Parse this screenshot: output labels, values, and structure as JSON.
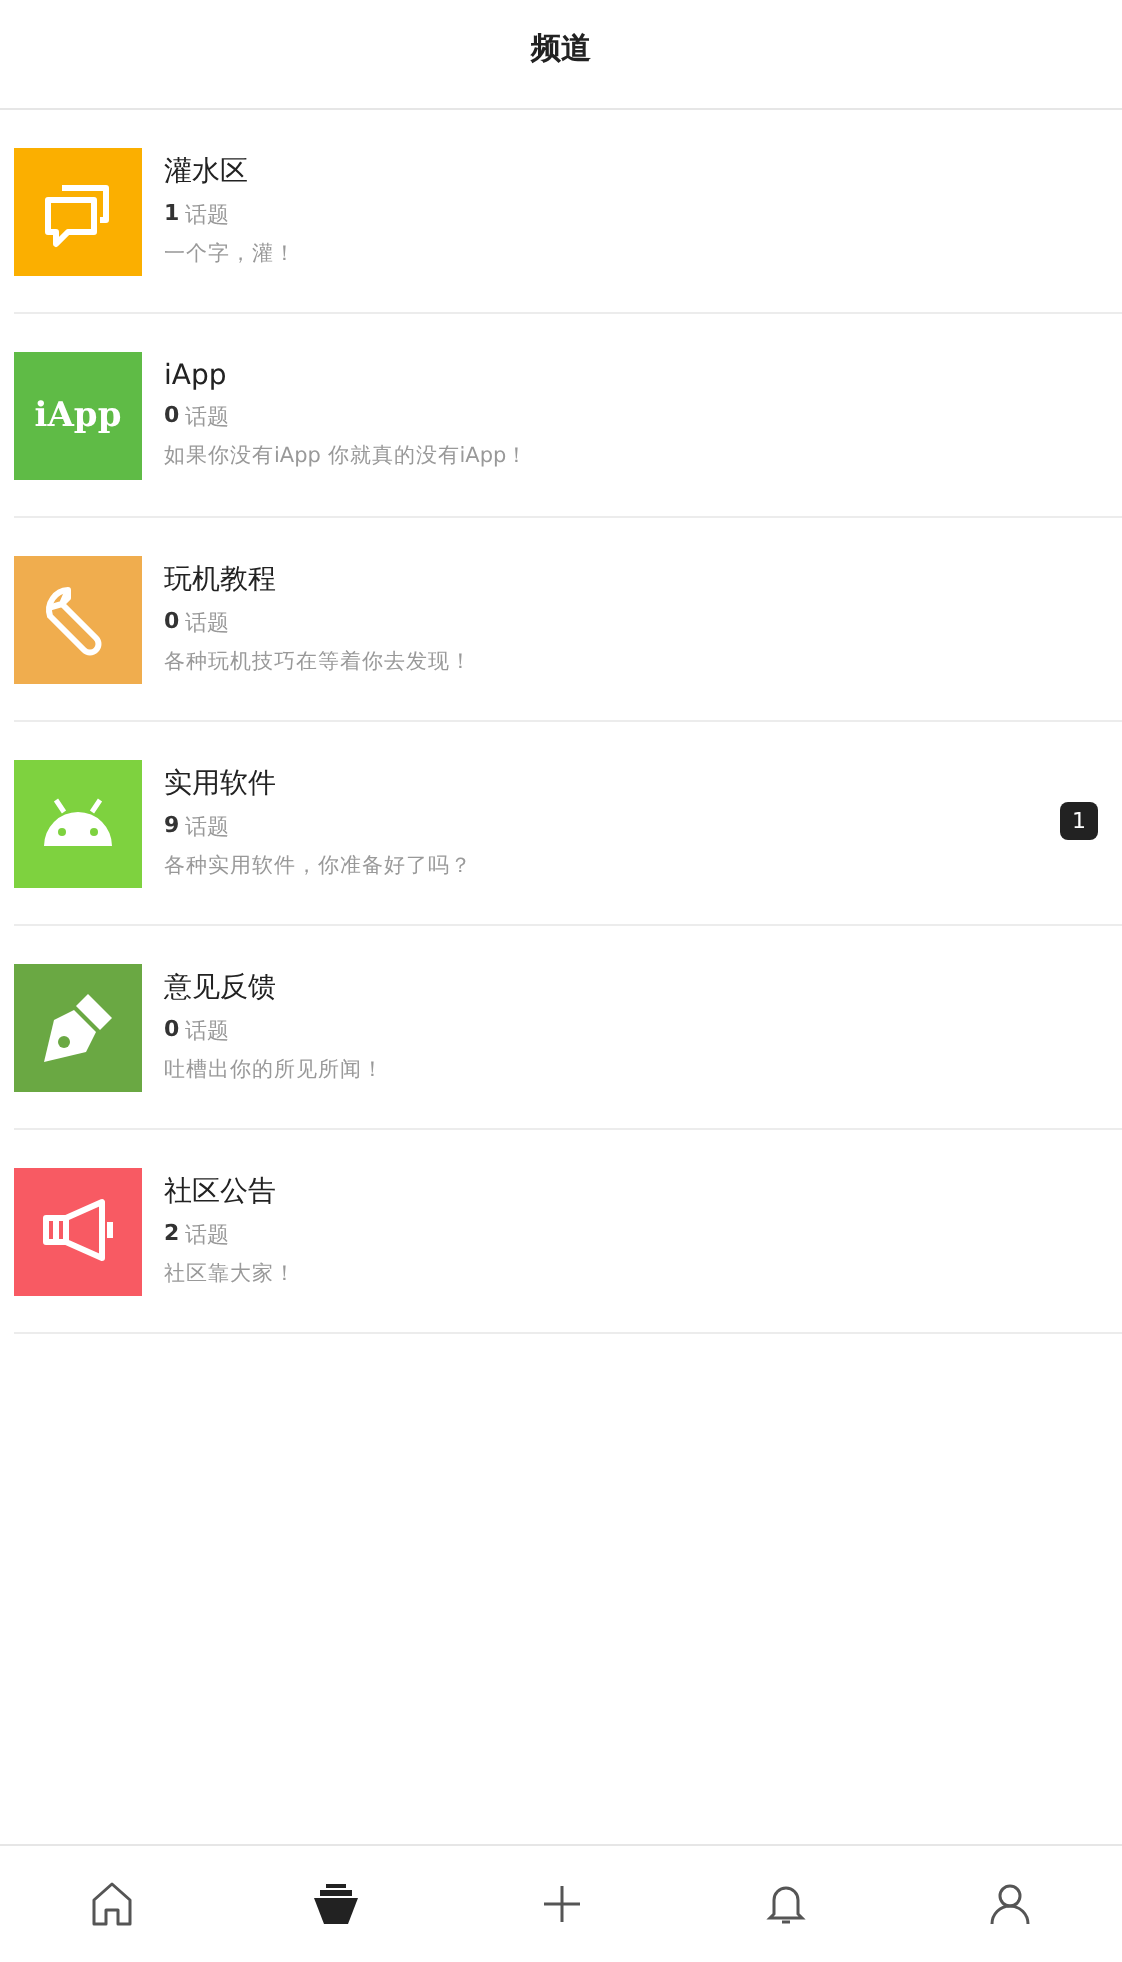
{
  "header": {
    "title": "频道"
  },
  "channels": [
    {
      "kind": "chat",
      "color": "#fbaf00",
      "name": "灌水区",
      "count": "1",
      "unit": "话题",
      "description": "一个字，灌！"
    },
    {
      "kind": "iapp",
      "icon_text": "iApp",
      "color": "#5fbb46",
      "name": "iApp",
      "count": "0",
      "unit": "话题",
      "description": "如果你没有iApp 你就真的没有iApp！"
    },
    {
      "kind": "wrench",
      "color": "#f0ad4e",
      "name": "玩机教程",
      "count": "0",
      "unit": "话题",
      "description": "各种玩机技巧在等着你去发现！"
    },
    {
      "kind": "android",
      "color": "#7ed23f",
      "name": "实用软件",
      "count": "9",
      "unit": "话题",
      "description": "各种实用软件，你准备好了吗？",
      "badge": "1"
    },
    {
      "kind": "pen",
      "color": "#6aa843",
      "name": "意见反馈",
      "count": "0",
      "unit": "话题",
      "description": "吐槽出你的所见所闻！"
    },
    {
      "kind": "megaphone",
      "color": "#f85a63",
      "name": "社区公告",
      "count": "2",
      "unit": "话题",
      "description": "社区靠大家！"
    }
  ],
  "nav": [
    {
      "kind": "home",
      "selected": false
    },
    {
      "kind": "channels",
      "selected": true
    },
    {
      "kind": "plus",
      "selected": false
    },
    {
      "kind": "bell",
      "selected": false
    },
    {
      "kind": "person",
      "selected": false
    }
  ]
}
